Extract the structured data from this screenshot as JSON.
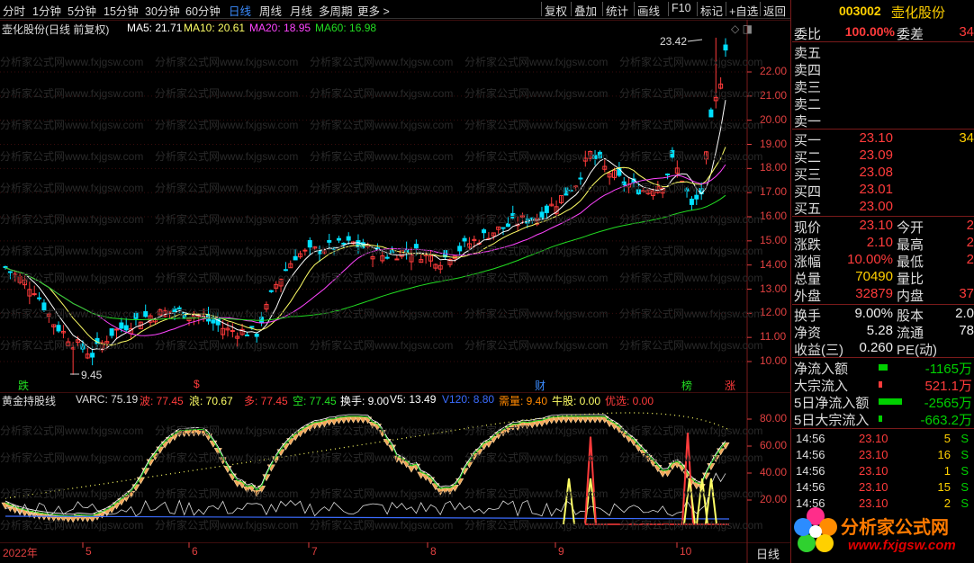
{
  "toolbar": {
    "periods": [
      "分时",
      "1分钟",
      "5分钟",
      "15分钟",
      "30分钟",
      "60分钟",
      "日线",
      "周线",
      "月线",
      "多周期",
      "更多 >"
    ],
    "active_period": "日线",
    "buttons": [
      "复权",
      "叠加",
      "统计",
      "画线",
      "F10",
      "标记",
      "+自选",
      "返回"
    ]
  },
  "stock": {
    "code": "003002",
    "name": "壶化股份"
  },
  "main": {
    "title": "壶化股份(日线 前复权)",
    "ma": [
      {
        "label": "MA5: 21.71",
        "color": "#ffffff"
      },
      {
        "label": "MA10: 20.61",
        "color": "#ffff66"
      },
      {
        "label": "MA20: 18.95",
        "color": "#ff44ff"
      },
      {
        "label": "MA60: 16.98",
        "color": "#22dd22"
      }
    ],
    "high_label": "23.42",
    "low_label": "9.45",
    "axis": [
      "22.00",
      "21.00",
      "20.00",
      "19.00",
      "18.00",
      "17.00",
      "16.00",
      "15.00",
      "14.00",
      "13.00",
      "12.00",
      "11.00",
      "10.00"
    ],
    "events": [
      {
        "label": "跌",
        "color": "#22dd22"
      },
      {
        "label": "$",
        "color": "#ff3b3b"
      },
      {
        "label": "财",
        "color": "#3b8cff"
      },
      {
        "label": "榜",
        "color": "#22dd22"
      },
      {
        "label": "涨",
        "color": "#ff3b3b"
      }
    ]
  },
  "indicator": {
    "name": "黄金持股线",
    "legend": [
      {
        "label": "VARC: 75.19",
        "color": "#dddddd"
      },
      {
        "label": "波: 77.45",
        "color": "#ff3b3b"
      },
      {
        "label": "浪: 70.67",
        "color": "#ffff66"
      },
      {
        "label": "多: 77.45",
        "color": "#ff3b3b"
      },
      {
        "label": "空: 77.45",
        "color": "#22dd22"
      },
      {
        "label": "换手: 9.00",
        "color": "#ffffff"
      },
      {
        "label": "V5: 13.49",
        "color": "#ffffff"
      },
      {
        "label": "V120: 8.80",
        "color": "#3b6cff"
      },
      {
        "label": "需量: 9.40",
        "color": "#ff8800"
      },
      {
        "label": "牛股: 0.00",
        "color": "#ffff66"
      },
      {
        "label": "优选: 0.00",
        "color": "#ff3b3b"
      }
    ],
    "axis": [
      "80.00",
      "60.00",
      "40.00",
      "20.00"
    ]
  },
  "dates": {
    "year": "2022年",
    "months": [
      "5",
      "6",
      "7",
      "8",
      "9",
      "10"
    ],
    "period_tab": "日线"
  },
  "quote": {
    "weibi_label": "委比",
    "weibi_value": "100.00%",
    "weicha_label": "委差",
    "weicha_value": "34",
    "sells": [
      {
        "label": "卖五"
      },
      {
        "label": "卖四"
      },
      {
        "label": "卖三"
      },
      {
        "label": "卖二"
      },
      {
        "label": "卖一"
      }
    ],
    "buys": [
      {
        "label": "买一",
        "price": "23.10",
        "vol": "34"
      },
      {
        "label": "买二",
        "price": "23.09"
      },
      {
        "label": "买三",
        "price": "23.08"
      },
      {
        "label": "买四",
        "price": "23.01"
      },
      {
        "label": "买五",
        "price": "23.00"
      }
    ],
    "stats": [
      {
        "l1": "现价",
        "v1": "23.10",
        "c1": "red",
        "l2": "今开",
        "v2": "2"
      },
      {
        "l1": "涨跌",
        "v1": "2.10",
        "c1": "red",
        "l2": "最高",
        "v2": "2"
      },
      {
        "l1": "涨幅",
        "v1": "10.00%",
        "c1": "red",
        "l2": "最低",
        "v2": "2"
      },
      {
        "l1": "总量",
        "v1": "70490",
        "c1": "yellow",
        "l2": "量比",
        "v2": ""
      },
      {
        "l1": "外盘",
        "v1": "32879",
        "c1": "red",
        "l2": "内盘",
        "v2": "37"
      }
    ],
    "stats2": [
      {
        "l1": "换手",
        "v1": "9.00%",
        "c1": "white",
        "l2": "股本",
        "v2": "2.0"
      },
      {
        "l1": "净资",
        "v1": "5.28",
        "c1": "white",
        "l2": "流通",
        "v2": "78"
      },
      {
        "l1": "收益(三)",
        "v1": "0.260",
        "c1": "white",
        "l2": "PE(动)",
        "v2": ""
      }
    ],
    "flows": [
      {
        "label": "净流入额",
        "value": "-1165万",
        "color": "#00d000"
      },
      {
        "label": "大宗流入",
        "value": "521.1万",
        "color": "#ff3b3b"
      },
      {
        "label": "5日净流入额",
        "value": "-2565万",
        "color": "#00d000"
      },
      {
        "label": "5日大宗流入",
        "value": "-663.2万",
        "color": "#00d000"
      }
    ],
    "ticks": [
      {
        "time": "14:56",
        "price": "23.10",
        "vol": "5",
        "bs": "S"
      },
      {
        "time": "14:56",
        "price": "23.10",
        "vol": "16",
        "bs": "S"
      },
      {
        "time": "14:56",
        "price": "23.10",
        "vol": "1",
        "bs": "S"
      },
      {
        "time": "14:56",
        "price": "23.10",
        "vol": "15",
        "bs": "S"
      },
      {
        "time": "14:56",
        "price": "23.10",
        "vol": "2",
        "bs": "S"
      }
    ]
  },
  "logo": {
    "text": "分析家公式网",
    "url": "www.fxjgsw.com"
  },
  "watermark": "分析家公式网www.fxjgsw.com",
  "colors": {
    "up": "#ff3b3b",
    "down": "#00e0ff",
    "grid": "#7a1a1a",
    "axis": "#e04040"
  }
}
